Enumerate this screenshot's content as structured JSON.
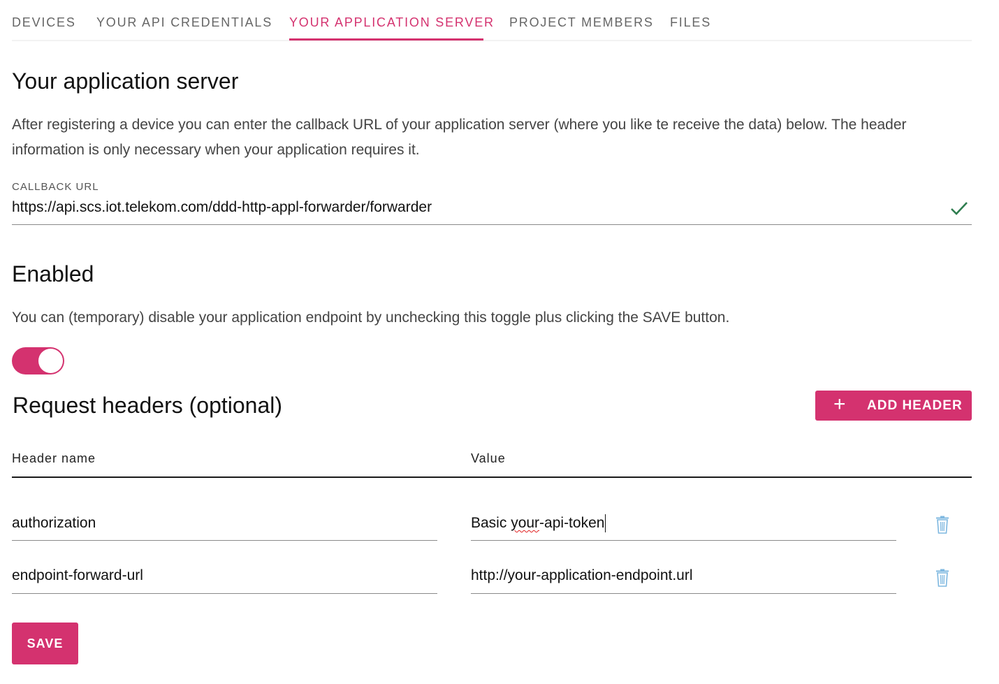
{
  "tabs": [
    {
      "label": "DEVICES"
    },
    {
      "label": "YOUR API CREDENTIALS"
    },
    {
      "label": "YOUR APPLICATION SERVER"
    },
    {
      "label": "PROJECT MEMBERS"
    },
    {
      "label": "FILES"
    }
  ],
  "app_server": {
    "title": "Your application server",
    "description": "After registering a device you can enter the callback URL of your application server (where you like te receive the data) below. The header information is only necessary when your application requires it.",
    "callback_label": "CALLBACK URL",
    "callback_value": "https://api.scs.iot.telekom.com/ddd-http-appl-forwarder/forwarder"
  },
  "enabled": {
    "title": "Enabled",
    "description": "You can (temporary) disable your application endpoint by unchecking this toggle plus clicking the SAVE button.",
    "toggle_on": true
  },
  "headers": {
    "title": "Request headers (optional)",
    "add_button_label": "ADD HEADER",
    "col_name": "Header name",
    "col_value": "Value",
    "rows": [
      {
        "name": "authorization",
        "value_prefix": "Basic ",
        "value_flagged": "your",
        "value_suffix": "-api-token"
      },
      {
        "name": "endpoint-forward-url",
        "value": "http://your-application-endpoint.url"
      }
    ]
  },
  "save_label": "SAVE",
  "colors": {
    "accent": "#d4326f",
    "check": "#2e7d4f",
    "trash": "#7fb8e0"
  },
  "icons": {
    "check": "check-icon",
    "add": "plus-icon",
    "delete": "trash-icon"
  }
}
